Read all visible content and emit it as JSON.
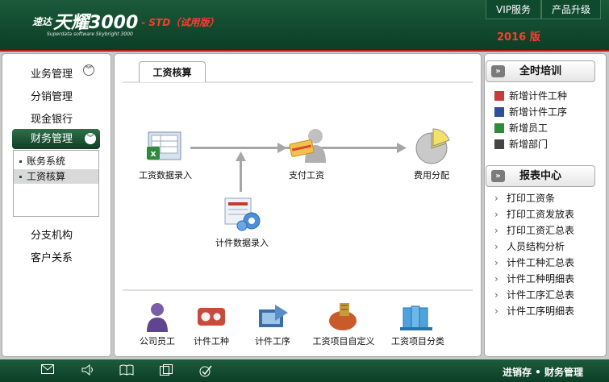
{
  "header": {
    "brand_prefix": "速达",
    "brand_name": "天耀3000",
    "edition": "- STD（试用版）",
    "tagline": "Superdata software Skybright 3000",
    "vip_label": "VIP服务",
    "upgrade_label": "产品升级",
    "year": "2016 版"
  },
  "sidebar": {
    "items": [
      {
        "label": "业务管理"
      },
      {
        "label": "分销管理"
      },
      {
        "label": "现金银行"
      },
      {
        "label": "财务管理"
      },
      {
        "label": "分支机构"
      },
      {
        "label": "客户关系"
      }
    ],
    "submenu": [
      "账务系统",
      "工资核算"
    ]
  },
  "main": {
    "tab_label": "工资核算",
    "flow": [
      {
        "label": "工资数据录入",
        "icon": "salary-entry-icon"
      },
      {
        "label": "支付工资",
        "icon": "pay-salary-icon"
      },
      {
        "label": "费用分配",
        "icon": "expense-pie-icon"
      },
      {
        "label": "计件数据录入",
        "icon": "piece-entry-icon"
      }
    ],
    "bottom": [
      {
        "label": "公司员工",
        "icon": "employee-icon"
      },
      {
        "label": "计件工种",
        "icon": "piece-type-icon"
      },
      {
        "label": "计件工序",
        "icon": "piece-process-icon"
      },
      {
        "label": "工资项目自定义",
        "icon": "salary-item-custom-icon"
      },
      {
        "label": "工资项目分类",
        "icon": "salary-item-category-icon"
      }
    ]
  },
  "right": {
    "training_title": "全时培训",
    "training_items": [
      "新增计件工种",
      "新增计件工序",
      "新增员工",
      "新增部门"
    ],
    "reports_title": "报表中心",
    "reports_items": [
      "打印工资条",
      "打印工资发放表",
      "打印工资汇总表",
      "人员结构分析",
      "计件工种汇总表",
      "计件工种明细表",
      "计件工序汇总表",
      "计件工序明细表"
    ]
  },
  "footer": {
    "text": "进销存 • 财务管理",
    "icons": [
      "mail-icon",
      "speaker-icon",
      "book-icon",
      "window-icon",
      "check-icon"
    ]
  },
  "colors": {
    "header_green": "#0c3e26",
    "accent_red": "#c21818",
    "brand_red": "#ff3b30"
  }
}
